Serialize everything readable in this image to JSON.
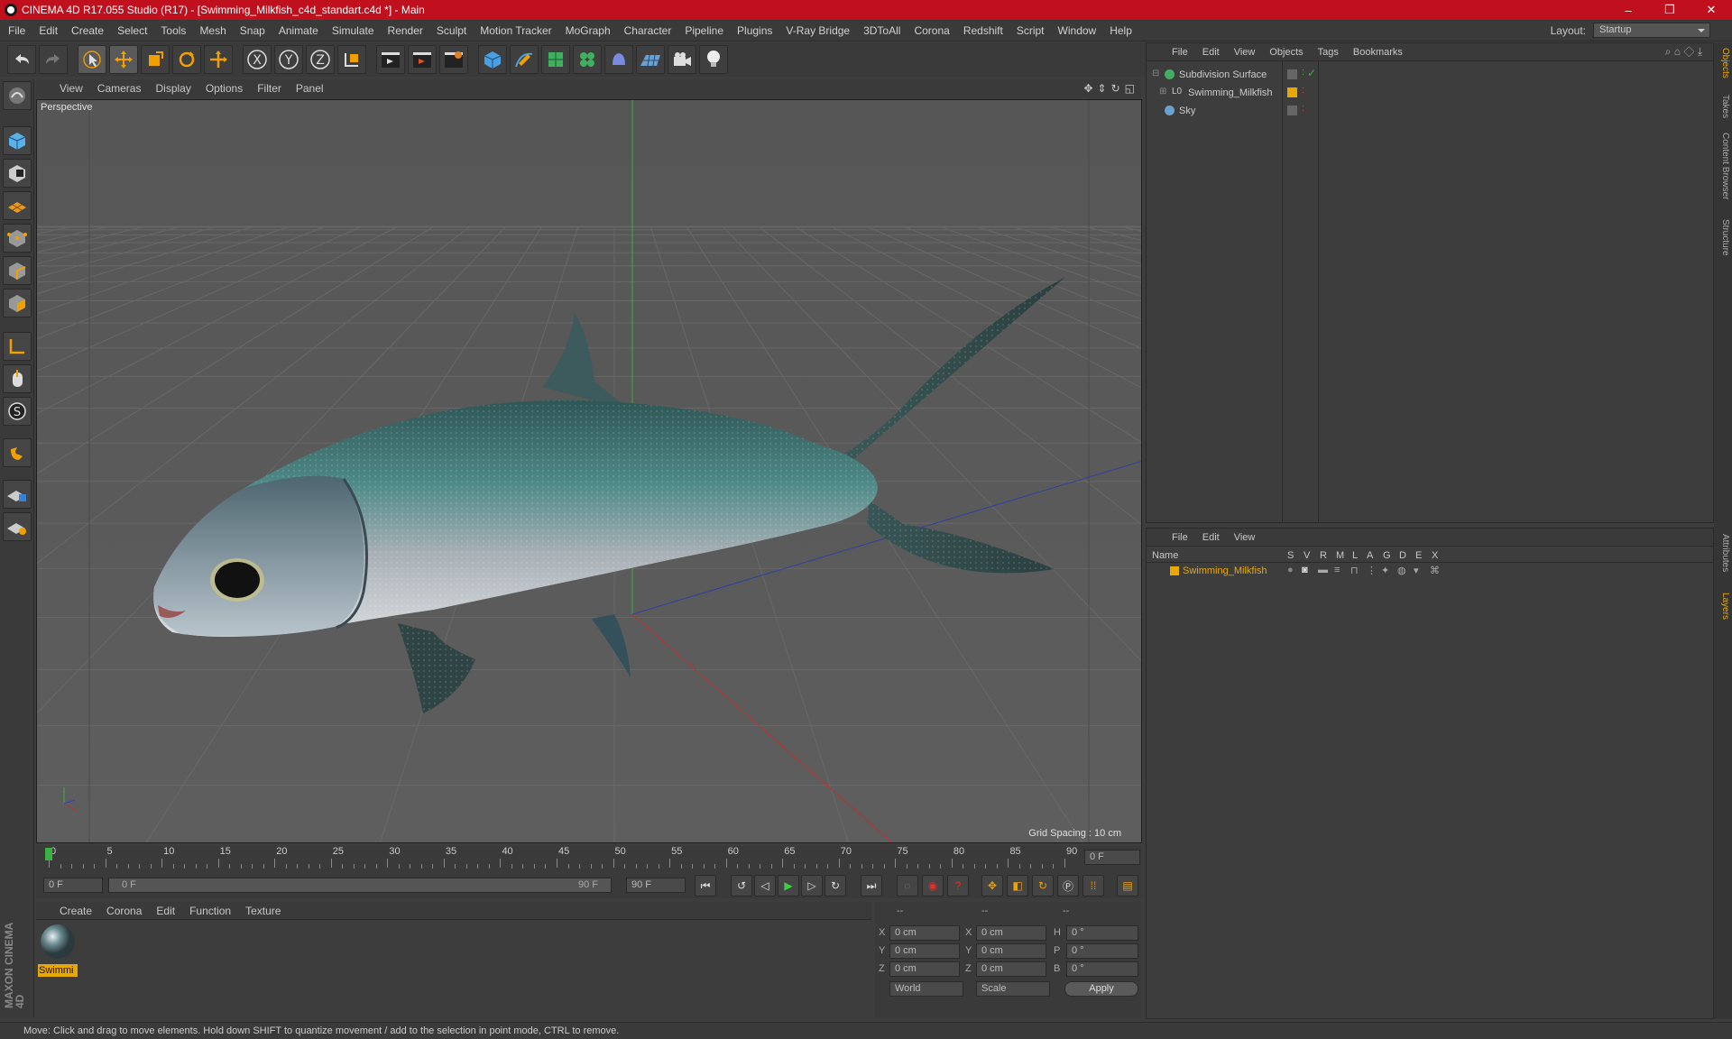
{
  "window": {
    "title": "CINEMA 4D R17.055 Studio (R17) - [Swimming_Milkfish_c4d_standart.c4d *] - Main",
    "controls": [
      "–",
      "❐",
      "✕"
    ]
  },
  "menubar": {
    "items": [
      "File",
      "Edit",
      "Create",
      "Select",
      "Tools",
      "Mesh",
      "Snap",
      "Animate",
      "Simulate",
      "Render",
      "Sculpt",
      "Motion Tracker",
      "MoGraph",
      "Character",
      "Pipeline",
      "Plugins",
      "V-Ray Bridge",
      "3DToAll",
      "Corona",
      "Redshift",
      "Script",
      "Window",
      "Help"
    ],
    "layout_label": "Layout:",
    "layout_value": "Startup"
  },
  "toolbar": {
    "axis_labels": [
      "X",
      "Y",
      "Z"
    ]
  },
  "viewport": {
    "menu": [
      "View",
      "Cameras",
      "Display",
      "Options",
      "Filter",
      "Panel"
    ],
    "label": "Perspective",
    "grid_spacing": "Grid Spacing : 10 cm"
  },
  "timeline": {
    "ticks": [
      "0",
      "5",
      "10",
      "15",
      "20",
      "25",
      "30",
      "35",
      "40",
      "45",
      "50",
      "55",
      "60",
      "65",
      "70",
      "75",
      "80",
      "85",
      "90"
    ],
    "current_frame": "0 F",
    "start_field": "0 F",
    "range_start": "0 F",
    "range_end": "90 F",
    "end_field": "90 F"
  },
  "materials": {
    "menu": [
      "Create",
      "Corona",
      "Edit",
      "Function",
      "Texture"
    ],
    "items": [
      {
        "name": "Swimmi"
      }
    ]
  },
  "coordinates": {
    "header": [
      "--",
      "--",
      "--"
    ],
    "rows": [
      {
        "a": "X",
        "av": "0 cm",
        "b": "X",
        "bv": "0 cm",
        "c": "H",
        "cv": "0 °"
      },
      {
        "a": "Y",
        "av": "0 cm",
        "b": "Y",
        "bv": "0 cm",
        "c": "P",
        "cv": "0 °"
      },
      {
        "a": "Z",
        "av": "0 cm",
        "b": "Z",
        "bv": "0 cm",
        "c": "B",
        "cv": "0 °"
      }
    ],
    "mode1": "World",
    "mode2": "Scale",
    "apply": "Apply"
  },
  "objects_panel": {
    "menu": [
      "File",
      "Edit",
      "View",
      "Objects",
      "Tags",
      "Bookmarks"
    ],
    "objects": [
      {
        "name": "Subdivision Surface"
      },
      {
        "name": "Swimming_Milkfish"
      },
      {
        "name": "Sky"
      }
    ]
  },
  "layers_panel": {
    "menu": [
      "File",
      "Edit",
      "View"
    ],
    "columns": [
      "Name",
      "S",
      "V",
      "R",
      "M",
      "L",
      "A",
      "G",
      "D",
      "E",
      "X"
    ],
    "layers": [
      {
        "name": "Swimming_Milkfish",
        "color": "#e8a800"
      }
    ]
  },
  "side_tabs": [
    "Objects",
    "Takes",
    "Content Browser",
    "Structure",
    "Attributes",
    "Layers"
  ],
  "brand": "MAXON CINEMA 4D",
  "status": "Move: Click and drag to move elements. Hold down SHIFT to quantize movement / add to the selection in point mode, CTRL to remove.",
  "colors": {
    "accent": "#e8a800",
    "title_bar": "#c0101e"
  }
}
